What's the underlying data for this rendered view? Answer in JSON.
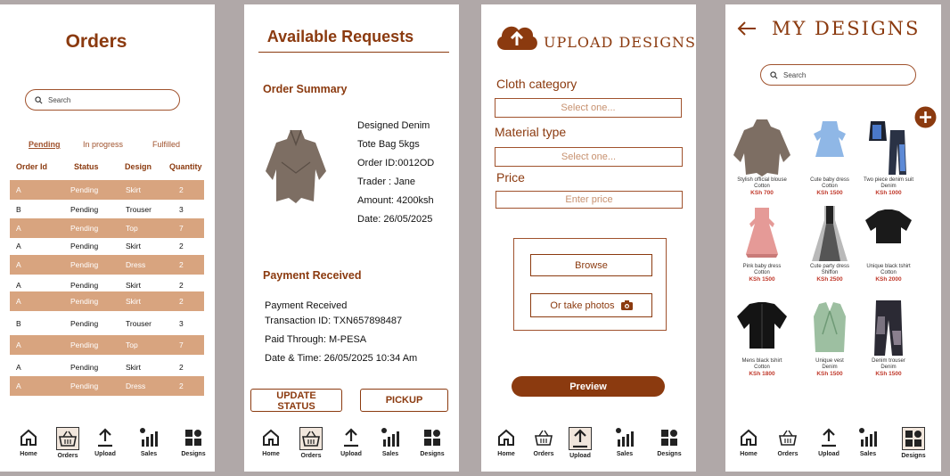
{
  "nav": {
    "home": "Home",
    "orders": "Orders",
    "upload": "Upload",
    "sales": "Sales",
    "designs": "Designs"
  },
  "orders_screen": {
    "title": "Orders",
    "search_placeholder": "Search",
    "tabs": [
      "Pending",
      "In progress",
      "Fulfilled"
    ],
    "headers": [
      "Order Id",
      "Status",
      "Design",
      "Quantity"
    ],
    "rows": [
      {
        "id": "A",
        "status": "Pending",
        "design": "Skirt",
        "qty": "2"
      },
      {
        "id": "B",
        "status": "Pending",
        "design": "Trouser",
        "qty": "3"
      },
      {
        "id": "A",
        "status": "Pending",
        "design": "Top",
        "qty": "7"
      },
      {
        "id": "A",
        "status": "Pending",
        "design": "Skirt",
        "qty": "2"
      },
      {
        "id": "A",
        "status": "Pending",
        "design": "Dress",
        "qty": "2"
      },
      {
        "id": "A",
        "status": "Pending",
        "design": "Skirt",
        "qty": "2"
      },
      {
        "id": "A",
        "status": "Pending",
        "design": "Skirt",
        "qty": "2"
      },
      {
        "id": "B",
        "status": "Pending",
        "design": "Trouser",
        "qty": "3"
      },
      {
        "id": "A",
        "status": "Pending",
        "design": "Top",
        "qty": "7"
      },
      {
        "id": "A",
        "status": "Pending",
        "design": "Skirt",
        "qty": "2"
      },
      {
        "id": "A",
        "status": "Pending",
        "design": "Dress",
        "qty": "2"
      }
    ]
  },
  "requests_screen": {
    "title": "Available Requests",
    "summary_heading": "Order Summary",
    "item_name": "Designed Denim",
    "item_detail": "Tote  Bag 5kgs",
    "order_id": "Order ID:0012OD",
    "trader": "Trader : Jane",
    "amount": "Amount: 4200ksh",
    "date": "Date:   26/05/2025",
    "payment_heading": "Payment Received",
    "payment_status": "Payment Received",
    "transaction": "Transaction ID: TXN657898487",
    "paid_through": "Paid  Through: M-PESA",
    "datetime": "Date & Time: 26/05/2025  10:34 Am",
    "update_btn": "UPDATE STATUS",
    "pickup_btn": "PICKUP"
  },
  "upload_screen": {
    "title": "UPLOAD DESIGNS",
    "category_label": "Cloth category",
    "category_value": "Select one...",
    "material_label": "Material type",
    "material_value": "Select one...",
    "price_label": "Price",
    "price_placeholder": "Enter price",
    "browse_btn": "Browse",
    "photo_btn": "Or take photos",
    "preview_btn": "Preview"
  },
  "designs_screen": {
    "title": "MY DESIGNS",
    "search_placeholder": "Search",
    "products": [
      {
        "name": "Stylish official blouse",
        "material": "Cotton",
        "price": "KSh 700"
      },
      {
        "name": "Cute baby dress",
        "material": "Cotton",
        "price": "KSh 1500"
      },
      {
        "name": "Two piece denim suit",
        "material": "Denim",
        "price": "KSh 1000"
      },
      {
        "name": "Pink baby dress",
        "material": "Cotton",
        "price": "KSh 1500"
      },
      {
        "name": "Cute party dress",
        "material": "Shiffon",
        "price": "KSh 2500"
      },
      {
        "name": "Unique black tshirt",
        "material": "Cotton",
        "price": "KSh 2000"
      },
      {
        "name": "Mens black tshirt",
        "material": "Cotton",
        "price": "KSh 1800"
      },
      {
        "name": "Unique vest",
        "material": "Denim",
        "price": "KSh 1500"
      },
      {
        "name": "Denim trouser",
        "material": "Denim",
        "price": "KSh 1500"
      }
    ]
  },
  "colors": {
    "brand": "#8b3a0f",
    "row_highlight": "#d8a47f",
    "preview": "#8b3a0f"
  }
}
